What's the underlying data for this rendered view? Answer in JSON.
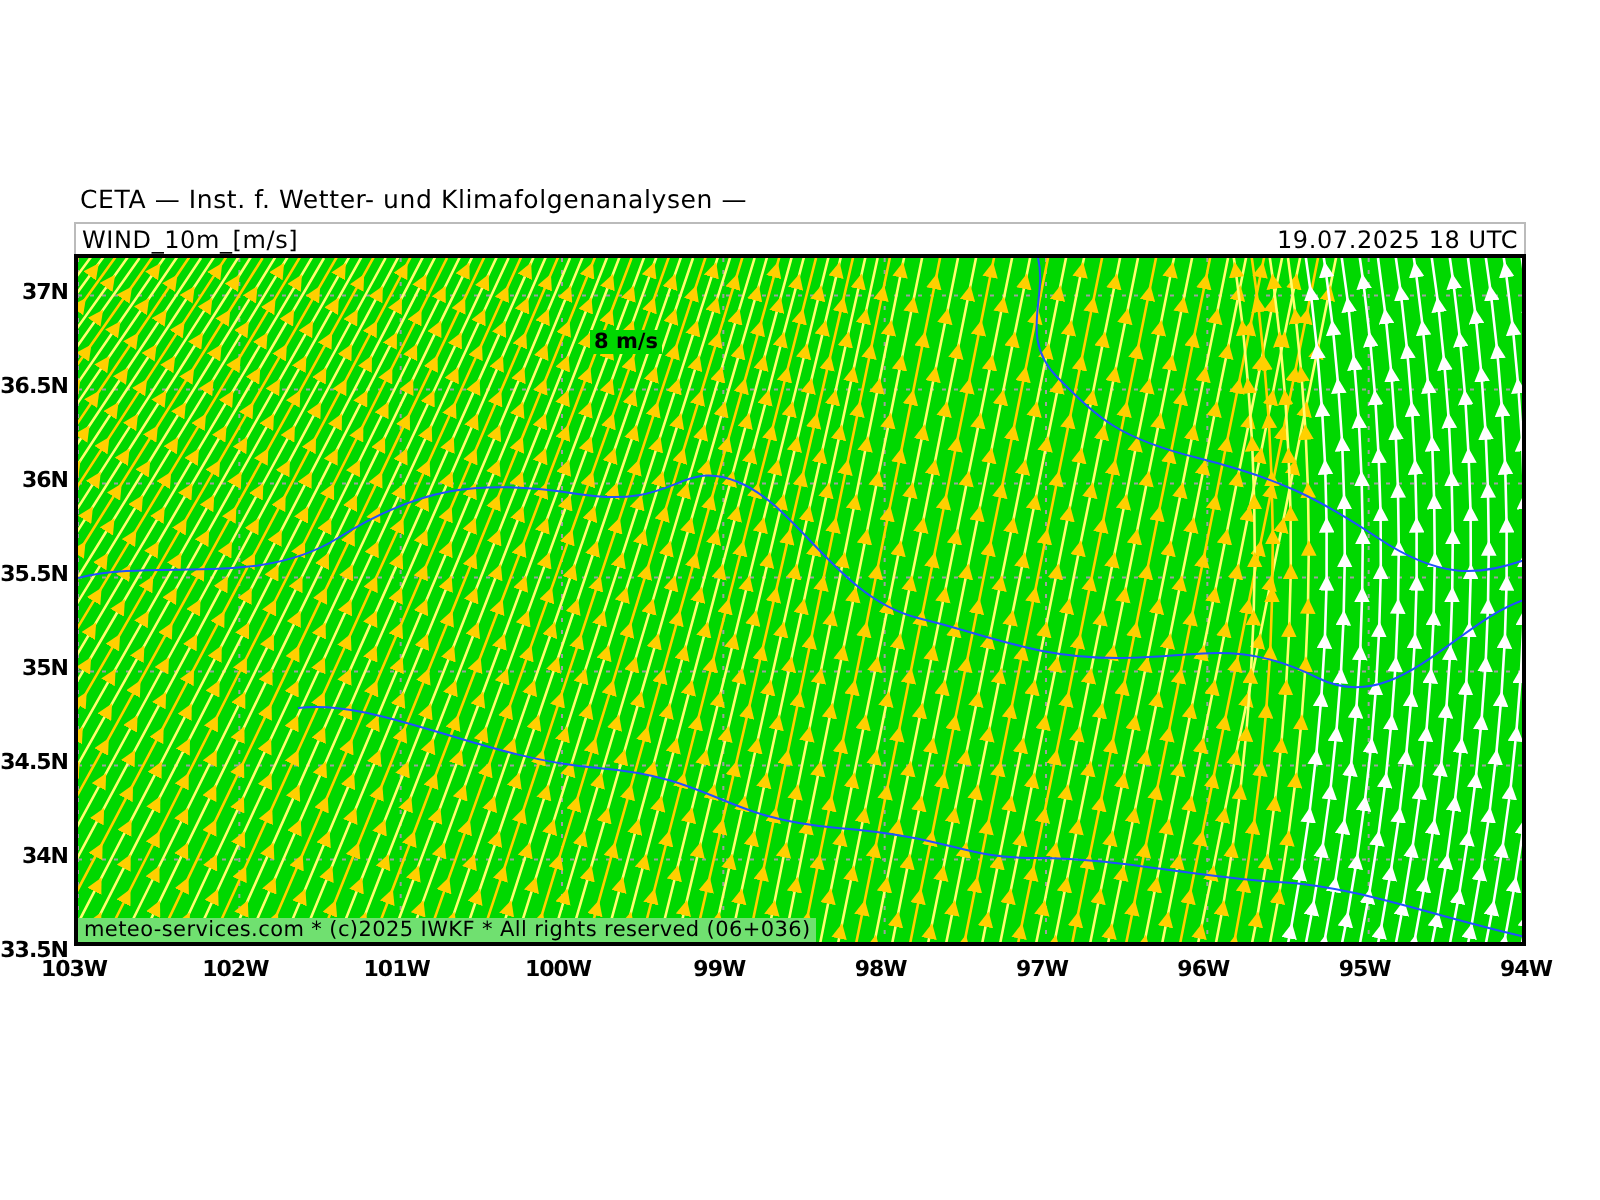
{
  "title": "CETA — Inst. f. Wetter- und Klimafolgenanalysen —",
  "header": {
    "variable": "WIND_10m_[m/s]",
    "datetime": "19.07.2025 18 UTC"
  },
  "map": {
    "speed_label": "8 m/s",
    "attribution": "meteo-services.com * (c)2025 IWKF * All rights reserved (06+036)"
  },
  "y_ticks": [
    "37N",
    "36.5N",
    "36N",
    "35.5N",
    "35N",
    "34.5N",
    "34N",
    "33.5N"
  ],
  "x_ticks": [
    "103W",
    "102W",
    "101W",
    "100W",
    "99W",
    "98W",
    "97W",
    "96W",
    "95W",
    "94W"
  ]
}
